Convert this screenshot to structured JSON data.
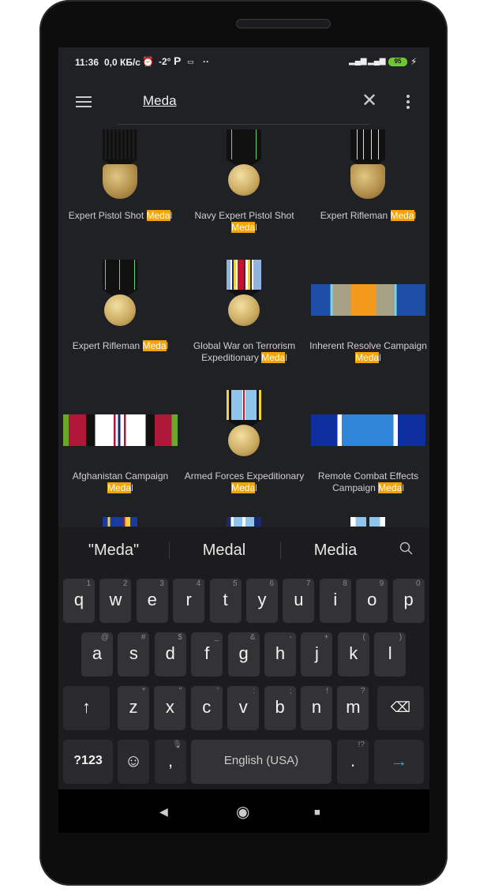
{
  "status_bar": {
    "time": "11:36",
    "net_speed": "0,0 КБ/с",
    "temperature": "-2°",
    "battery": "95",
    "icons": [
      "alarm-icon",
      "parking-icon",
      "keyboard-icon",
      "dots-icon",
      "signal-icon",
      "signal-4g-icon",
      "battery-icon",
      "charging-icon"
    ]
  },
  "toolbar": {
    "search_value": "Meda",
    "icons": [
      "menu-icon",
      "close-icon",
      "more-vert-icon"
    ]
  },
  "highlight_color": "#f5a300",
  "results": [
    {
      "pre": "Expert Pistol Shot ",
      "hl": "Meda",
      "post": "l",
      "art": "shield",
      "ribbon": "repeating-linear-gradient(90deg,#111 0 3px,#1e1e1e 3px 5px)"
    },
    {
      "pre": "Navy Expert Pistol Shot ",
      "hl": "Meda",
      "post": "l",
      "art": "disc",
      "ribbon": "linear-gradient(90deg,#111 0 6px,#6fcf7a 6px 7px,#111 7px 37px,#6fcf7a 37px 38px,#111 38px)"
    },
    {
      "pre": "Expert Rifleman ",
      "hl": "Meda",
      "post": "l",
      "art": "shield",
      "ribbon": "linear-gradient(90deg,#111 0 8px,#ddd 8px 9px,#111 9px 16px,#ddd 16px 17px,#111 17px 26px,#ddd 26px 27px,#111 27px 35px,#ddd 35px 36px,#111 36px)"
    },
    {
      "pre": "Expert Rifleman ",
      "hl": "Meda",
      "post": "l",
      "art": "disc",
      "ribbon": "linear-gradient(90deg,#111 0 3px,#6fcf7a 3px 4px,#111 4px 21px,#6fcf7a 21px 22px,#111 22px 40px,#6fcf7a 40px 41px,#111 41px)"
    },
    {
      "pre": "Global War on Terrorism Expeditionary ",
      "hl": "Meda",
      "post": "l",
      "art": "disc",
      "ribbon": "linear-gradient(90deg,#8fb4e0 0 5px,#fff 5px 7px,#1a2a6c 7px 9px,#f2d23a 9px 12px,#fff 12px 14px,#c8102e 14px 22px,#1a2a6c 22px 24px,#fff 24px 27px,#f2d23a 27px 30px,#1a2a6c 30px 32px,#fff 32px 34px,#8fb4e0 34px)"
    },
    {
      "pre": "Inherent Resolve Campaign ",
      "hl": "Meda",
      "post": "l",
      "art": "bar",
      "ribbon": "linear-gradient(90deg,#1d4fa6 0 17%,#7fd3e6 17% 19%,#a7a285 19% 35%,#f39a1c 35% 57%,#a7a285 57% 73%,#7fd3e6 73% 75%,#1d4fa6 75%)"
    },
    {
      "pre": "Afghanistan Campaign ",
      "hl": "Meda",
      "post": "l",
      "art": "bar",
      "ribbon": "linear-gradient(90deg,#6aa72c 0 5%,#b0183a 5% 20%,#111 20% 28%,#fff 28% 44%,#b0183a 44% 46%,#fff 46% 48%,#1a2a6c 48% 50%,#fff 50% 53%,#b0183a 53% 55%,#fff 55% 72%,#111 72% 80%,#b0183a 80% 95%,#6aa72c 95%)"
    },
    {
      "pre": "Armed Forces Expeditionary ",
      "hl": "Meda",
      "post": "l",
      "art": "disc",
      "ribbon": "linear-gradient(90deg,#f2d23a 0 3px,#111 3px 6px,#8fc4ec 6px 20px,#fff 20px 21px,#c8102e 21px 23px,#fff 23px 24px,#8fc4ec 24px 38px,#111 38px 41px,#f2d23a 41px)"
    },
    {
      "pre": "Remote Combat Effects Campaign ",
      "hl": "Meda",
      "post": "l",
      "art": "bar",
      "ribbon": "linear-gradient(90deg,#0e2fa0 0 23%,#fff 23% 27%,#2f86d8 27% 72%,#fff 72% 76%,#0e2fa0 76%)"
    }
  ],
  "partial_results": [
    {
      "ribbon": "linear-gradient(90deg,#1a3aa0 0 15%,#f2d23a 15% 22%,#1a3aa0 22% 60%,#c8102e 60% 65%,#f2d23a 65% 80%,#1a3aa0 80%)"
    },
    {
      "ribbon": "linear-gradient(90deg,#1a2a6c 0 12%,#fff 12% 20%,#8fc4ec 20% 45%,#fff 45% 55%,#8fc4ec 55% 80%,#1a2a6c 80%)"
    },
    {
      "ribbon": "linear-gradient(90deg,#fff 0 15%,#8fc4ec 15% 45%,#222 45% 55%,#8fc4ec 55% 85%,#fff 85%)"
    }
  ],
  "suggestions": [
    "\"Meda\"",
    "Medal",
    "Media"
  ],
  "keyboard": {
    "row1": [
      [
        "q",
        "1"
      ],
      [
        "w",
        "2"
      ],
      [
        "e",
        "3"
      ],
      [
        "r",
        "4"
      ],
      [
        "t",
        "5"
      ],
      [
        "y",
        "6"
      ],
      [
        "u",
        "7"
      ],
      [
        "i",
        "8"
      ],
      [
        "o",
        "9"
      ],
      [
        "p",
        "0"
      ]
    ],
    "row2": [
      [
        "a",
        "@"
      ],
      [
        "s",
        "#"
      ],
      [
        "d",
        "$"
      ],
      [
        "f",
        "_"
      ],
      [
        "g",
        "&"
      ],
      [
        "h",
        "-"
      ],
      [
        "j",
        "+"
      ],
      [
        "k",
        "("
      ],
      [
        "l",
        ")"
      ]
    ],
    "row3": [
      [
        "z",
        "*"
      ],
      [
        "x",
        "\""
      ],
      [
        "c",
        "'"
      ],
      [
        "v",
        ":"
      ],
      [
        "b",
        ";"
      ],
      [
        "n",
        "!"
      ],
      [
        "m",
        "?"
      ]
    ],
    "shift": "↑",
    "backspace": "⌫",
    "symbols": "?123",
    "emoji": "☺",
    "comma": ",",
    "space": "English (USA)",
    "period": ".",
    "period_hint": "!?",
    "enter": "→",
    "enter_color": "#2f9bea"
  },
  "nav": {
    "back": "◀",
    "home": "◉",
    "recents": "■"
  }
}
